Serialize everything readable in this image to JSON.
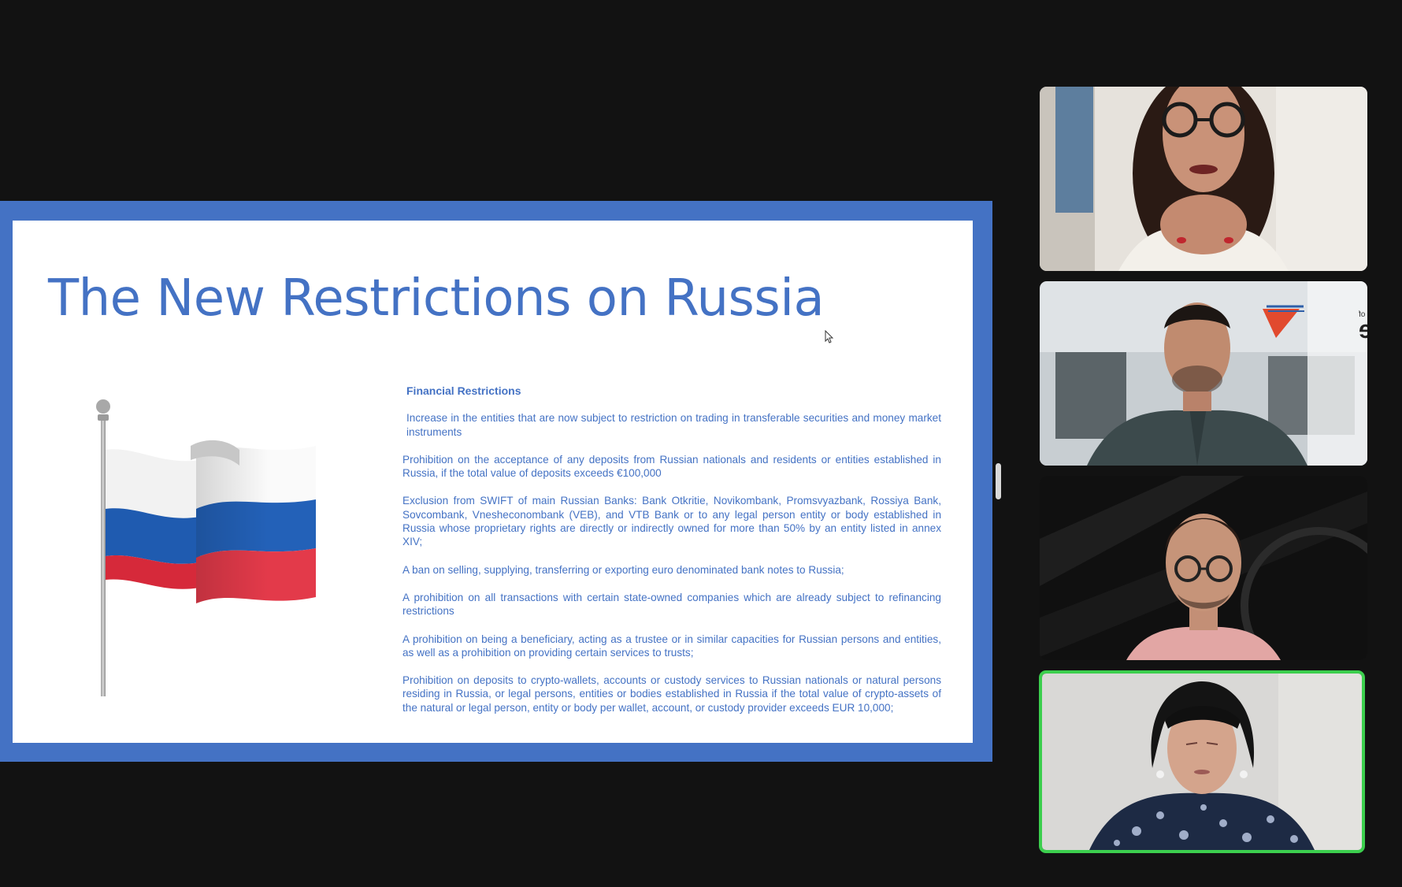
{
  "slide": {
    "title": "The New Restrictions on Russia",
    "section_title": "Financial Restrictions",
    "items": [
      "Increase in the entities that are now subject to restriction on trading in transferable securities and money market instruments",
      "Prohibition on the acceptance of any deposits from Russian nationals and residents or entities established in Russia, if the total value of deposits exceeds €100,000",
      "Exclusion from SWIFT of main Russian Banks: Bank Otkritie, Novikombank, Promsvyazbank, Rossiya Bank, Sovcombank, Vnesheconombank (VEB), and VTB Bank or to any legal person entity or body established in Russia whose proprietary rights are directly or indirectly owned for more than 50% by an entity listed in annex XIV;",
      "A ban on selling, supplying, transferring or exporting euro denominated bank notes to Russia;",
      "A prohibition on all transactions with certain state-owned companies which are already subject to refinancing restrictions",
      "A prohibition on being a beneficiary, acting as a trustee or in similar capacities for Russian persons and entities, as well as a prohibition on providing certain services to trusts;",
      "Prohibition on deposits to crypto-wallets, accounts or custody services to Russian nationals or natural persons residing in Russia, or legal persons, entities or bodies established in Russia if the total value of crypto-assets of the natural or legal person, entity or body per wallet, account, or custody provider exceeds EUR 10,000;"
    ]
  },
  "participant_tiles": [
    {
      "icon": "participant-video-1",
      "active": false
    },
    {
      "icon": "participant-video-2",
      "active": false,
      "background_logo": "sme"
    },
    {
      "icon": "participant-video-3",
      "active": false
    },
    {
      "icon": "participant-video-4",
      "active": true
    }
  ],
  "colors": {
    "background": "#121212",
    "slide_accent": "#4472c4",
    "active_speaker": "#3ccf4e"
  }
}
